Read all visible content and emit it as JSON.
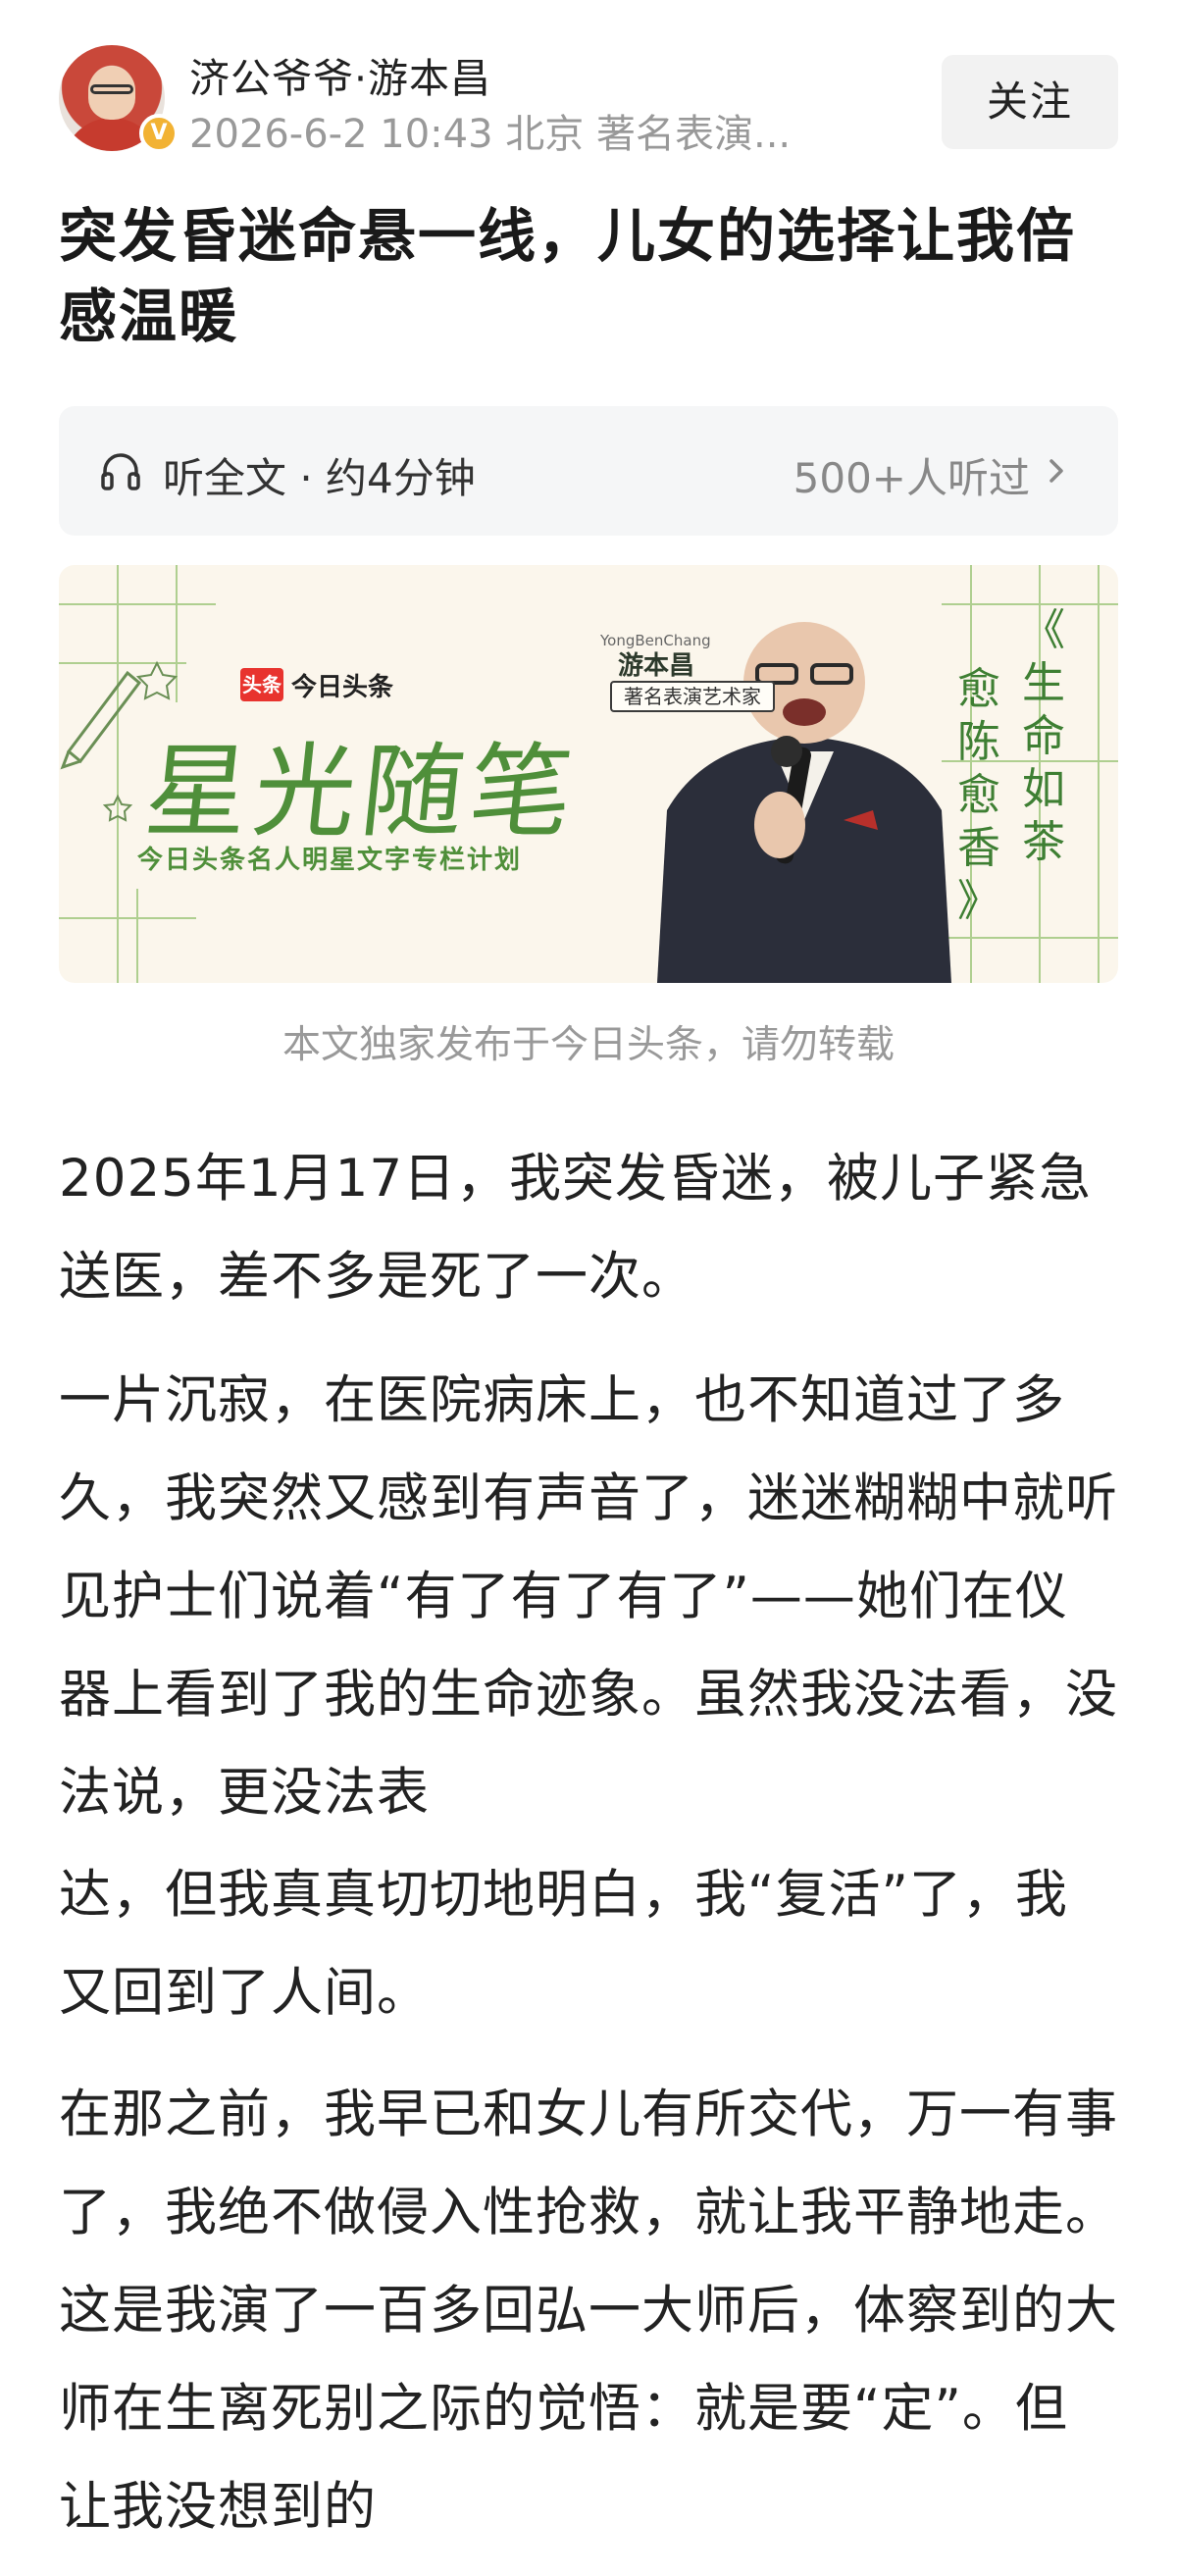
{
  "author": {
    "name": "济公爷爷·游本昌",
    "meta": "2026-6-2 10:43 北京 著名表演...",
    "verified_badge": "V"
  },
  "follow_label": "关注",
  "title": "突发昏迷命悬一线，儿女的选择让我倍感温暖",
  "listen": {
    "label": "听全文 · 约4分钟",
    "count": "500+人听过"
  },
  "banner": {
    "logo_mark": "头条",
    "logo_text": "今日头条",
    "column_title": "星光随笔",
    "column_subtitle": "今日头条名人明星文字专栏计划",
    "pinyin": "YongBenChang",
    "name": "游本昌",
    "role": "著名表演艺术家",
    "quote_col1": "《生命如茶",
    "quote_col2": "愈陈愈香》"
  },
  "caption": "本文独家发布于今日头条，请勿转载",
  "paragraphs": [
    "2025年1月17日，我突发昏迷，被儿子紧急送医，差不多是死了一次。",
    "一片沉寂，在医院病床上，也不知道过了多久，我突然又感到有声音了，迷迷糊糊中就听见护士们说着“有了有了有了”——她们在仪器上看到了我的生命迹象。虽然我没法看，没法说，更没法表",
    "达，但我真真切切地明白，我“复活”了，我又回到了人间。",
    "在那之前，我早已和女儿有所交代，万一有事了，我绝不做侵入性抢救，就让我平静地走。这是我演了一百多回弘一大师后，体察到的大师在生离死别之际的觉悟：就是要“定”。但让我没想到的"
  ],
  "colors": {
    "accent_green": "#4f8f3a",
    "toutiao_red": "#e8332e",
    "meta_gray": "#999999"
  }
}
